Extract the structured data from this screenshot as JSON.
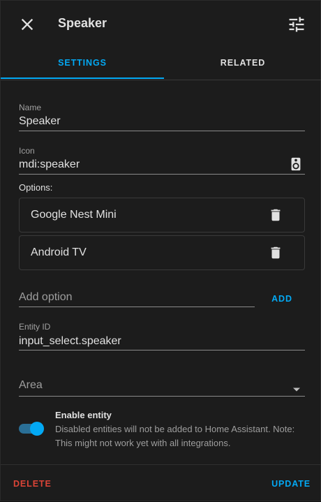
{
  "header": {
    "title": "Speaker"
  },
  "tabs": [
    {
      "label": "SETTINGS",
      "active": true
    },
    {
      "label": "RELATED",
      "active": false
    }
  ],
  "form": {
    "name": {
      "label": "Name",
      "value": "Speaker"
    },
    "icon": {
      "label": "Icon",
      "value": "mdi:speaker",
      "icon": "speaker-icon"
    },
    "options_label": "Options:",
    "options": [
      "Google Nest Mini",
      "Android TV"
    ],
    "add_option": {
      "placeholder": "Add option",
      "button_label": "ADD"
    },
    "entity_id": {
      "label": "Entity ID",
      "value": "input_select.speaker"
    },
    "area": {
      "placeholder": "Area"
    },
    "enable_entity": {
      "title": "Enable entity",
      "description": "Disabled entities will not be added to Home Assistant. Note: This might not work yet with all integrations.",
      "enabled": true
    }
  },
  "footer": {
    "delete_label": "DELETE",
    "update_label": "UPDATE"
  },
  "colors": {
    "accent": "#03a9f4",
    "danger": "#db4437",
    "surface": "#1c1c1c"
  }
}
